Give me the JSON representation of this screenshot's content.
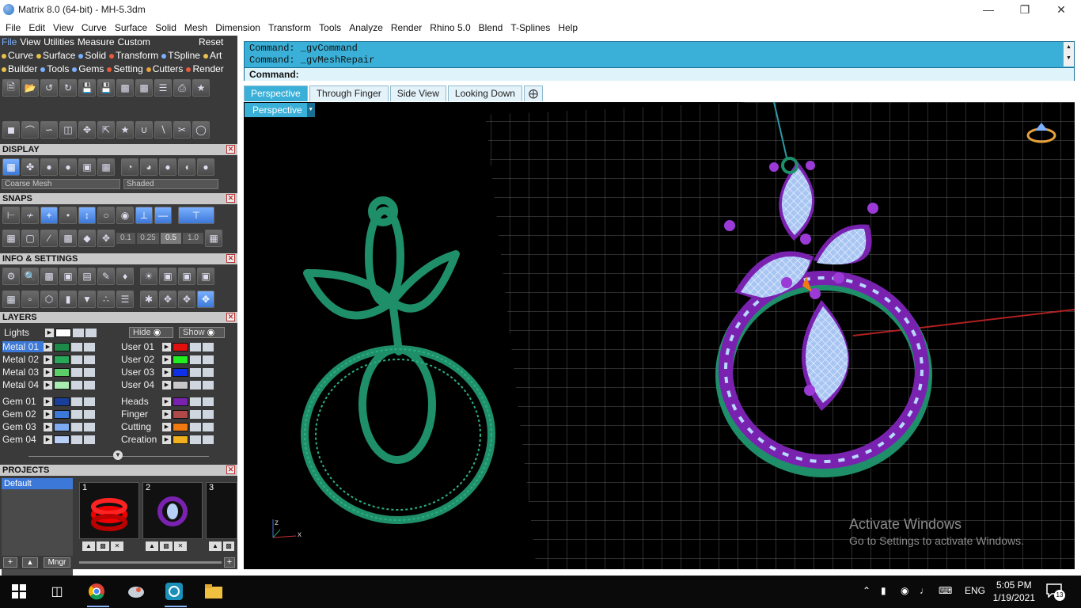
{
  "window": {
    "title": "Matrix 8.0 (64-bit) - MH-5.3dm",
    "controls": [
      "minimize-icon",
      "restore-icon",
      "close-icon"
    ]
  },
  "menubar": [
    "File",
    "Edit",
    "View",
    "Curve",
    "Surface",
    "Solid",
    "Mesh",
    "Dimension",
    "Transform",
    "Tools",
    "Analyze",
    "Render",
    "Rhino 5.0",
    "Blend",
    "T-Splines",
    "Help"
  ],
  "left_menu": {
    "row1": [
      "File",
      "View",
      "Utilities",
      "Measure",
      "Custom"
    ],
    "reset": "Reset",
    "row2": [
      {
        "label": "Curve",
        "color": "#e8c24a"
      },
      {
        "label": "Surface",
        "color": "#e8c24a"
      },
      {
        "label": "Solid",
        "color": "#7ab0ff"
      },
      {
        "label": "Transform",
        "color": "#e85a3a"
      },
      {
        "label": "TSpline",
        "color": "#7ab0ff"
      },
      {
        "label": "Art",
        "color": "#e8c24a"
      }
    ],
    "row3": [
      {
        "label": "Builder",
        "color": "#e8c24a"
      },
      {
        "label": "Tools",
        "color": "#7ab0ff"
      },
      {
        "label": "Gems",
        "color": "#7ab0ff"
      },
      {
        "label": "Setting",
        "color": "#e85a3a"
      },
      {
        "label": "Cutters",
        "color": "#e8a23a"
      },
      {
        "label": "Render",
        "color": "#e85a3a"
      }
    ]
  },
  "display": {
    "header": "DISPLAY",
    "mesh_select": "Coarse Mesh",
    "shade_select": "Shaded"
  },
  "snaps": {
    "header": "SNAPS",
    "values": [
      "0.1",
      "0.25",
      "0.5",
      "1.0"
    ]
  },
  "info": {
    "header": "INFO & SETTINGS"
  },
  "layers": {
    "header": "LAYERS",
    "lights_label": "Lights",
    "hide_label": "Hide",
    "show_label": "Show",
    "left": [
      {
        "name": "Metal 01",
        "color": "#1e8a4a"
      },
      {
        "name": "Metal 02",
        "color": "#2aa85a"
      },
      {
        "name": "Metal 03",
        "color": "#5ccf6a"
      },
      {
        "name": "Metal 04",
        "color": "#a8ecb0"
      },
      {
        "name": "Gem 01",
        "color": "#1a3f9a"
      },
      {
        "name": "Gem 02",
        "color": "#3c78d8"
      },
      {
        "name": "Gem 03",
        "color": "#7eaaf0"
      },
      {
        "name": "Gem 04",
        "color": "#b8d0f6"
      }
    ],
    "right": [
      {
        "name": "User 01",
        "color": "#e01010"
      },
      {
        "name": "User 02",
        "color": "#22ee22"
      },
      {
        "name": "User 03",
        "color": "#1030e8"
      },
      {
        "name": "User 04",
        "color": "#c8c8c8"
      },
      {
        "name": "Heads",
        "color": "#7a22b0"
      },
      {
        "name": "Finger",
        "color": "#b04a4a"
      },
      {
        "name": "Cutting",
        "color": "#f07a10"
      },
      {
        "name": "Creation",
        "color": "#f0b020"
      }
    ]
  },
  "projects": {
    "header": "PROJECTS",
    "selected": "Default",
    "thumbs": [
      "1",
      "2",
      "3"
    ],
    "manager_label": "Mngr"
  },
  "command": {
    "history": [
      "Command: _gvCommand",
      "Command: _gvMeshRepair"
    ],
    "prompt": "Command:"
  },
  "viewport_tabs": [
    "Perspective",
    "Through Finger",
    "Side View",
    "Looking Down"
  ],
  "viewport": {
    "label": "Perspective",
    "axis_z": "z",
    "axis_x": "x"
  },
  "watermark": {
    "line1": "Activate Windows",
    "line2": "Go to Settings to activate Windows."
  },
  "taskbar": {
    "language": "ENG",
    "time": "5:05 PM",
    "date": "1/19/2021",
    "notification_count": "13"
  }
}
